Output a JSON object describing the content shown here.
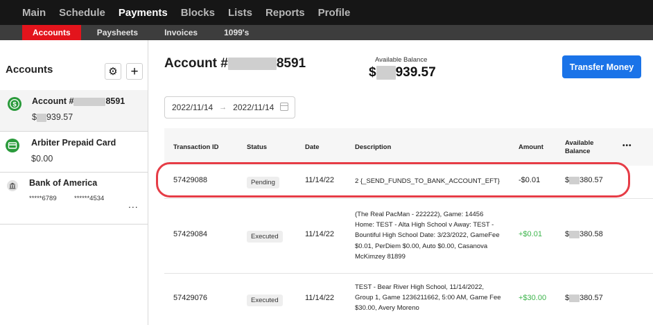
{
  "topnav": {
    "items": [
      "Main",
      "Schedule",
      "Payments",
      "Blocks",
      "Lists",
      "Reports",
      "Profile"
    ],
    "active": "Payments"
  },
  "subnav": {
    "items": [
      "Accounts",
      "Paysheets",
      "Invoices",
      "1099's"
    ],
    "active": "Accounts"
  },
  "sidebar": {
    "title": "Accounts",
    "accounts": [
      {
        "name_prefix": "Account #",
        "name_suffix": "8591",
        "balance_prefix": "$",
        "balance_suffix": "939.57",
        "icon": "dollar-icon",
        "icon_color": "#2a9a3b"
      },
      {
        "name": "Arbiter Prepaid Card",
        "balance": "$0.00",
        "icon": "card-icon",
        "icon_color": "#2a9a3b"
      },
      {
        "name": "Bank of America",
        "account_mask": "*****6789",
        "routing_mask": "******4534",
        "more": "...",
        "icon": "bank-icon"
      }
    ]
  },
  "main": {
    "title_prefix": "Account #",
    "title_suffix": "8591",
    "balance_label": "Available Balance",
    "balance_prefix": "$",
    "balance_suffix": "939.57",
    "transfer_label": "Transfer Money",
    "date_from": "2022/11/14",
    "date_arrow": "→",
    "date_to": "2022/11/14"
  },
  "table": {
    "headers": {
      "id": "Transaction ID",
      "status": "Status",
      "date": "Date",
      "description": "Description",
      "amount": "Amount",
      "available_line1": "Available",
      "available_line2": "Balance",
      "more": "•••"
    },
    "rows": [
      {
        "id": "57429088",
        "status": "Pending",
        "date": "11/14/22",
        "description": "2 {_SEND_FUNDS_TO_BANK_ACCOUNT_EFT}",
        "amount": "-$0.01",
        "balance_prefix": "$",
        "balance_suffix": "380.57"
      },
      {
        "id": "57429084",
        "status": "Executed",
        "date": "11/14/22",
        "description": "(The Real PacMan - 222222), Game: 14456 Home: TEST - Alta High School v Away: TEST - Bountiful High School Date: 3/23/2022, GameFee $0.01, PerDiem $0.00, Auto $0.00, Casanova McKimzey 81899",
        "amount": "+$0.01",
        "balance_prefix": "$",
        "balance_suffix": "380.58"
      },
      {
        "id": "57429076",
        "status": "Executed",
        "date": "11/14/22",
        "description": "TEST - Bear River High School, 11/14/2022, Group 1, Game 1236211662, 5:00 AM, Game Fee $30.00, Avery Moreno",
        "amount": "+$30.00",
        "balance_prefix": "$",
        "balance_suffix": "380.57"
      }
    ]
  },
  "colors": {
    "nav_bg": "#161616",
    "subnav_bg": "#3d3d3d",
    "active_tab": "#e3141c",
    "primary_button": "#1a73e8",
    "positive_amount": "#3bb44a",
    "highlight_ring": "#e63c46"
  }
}
